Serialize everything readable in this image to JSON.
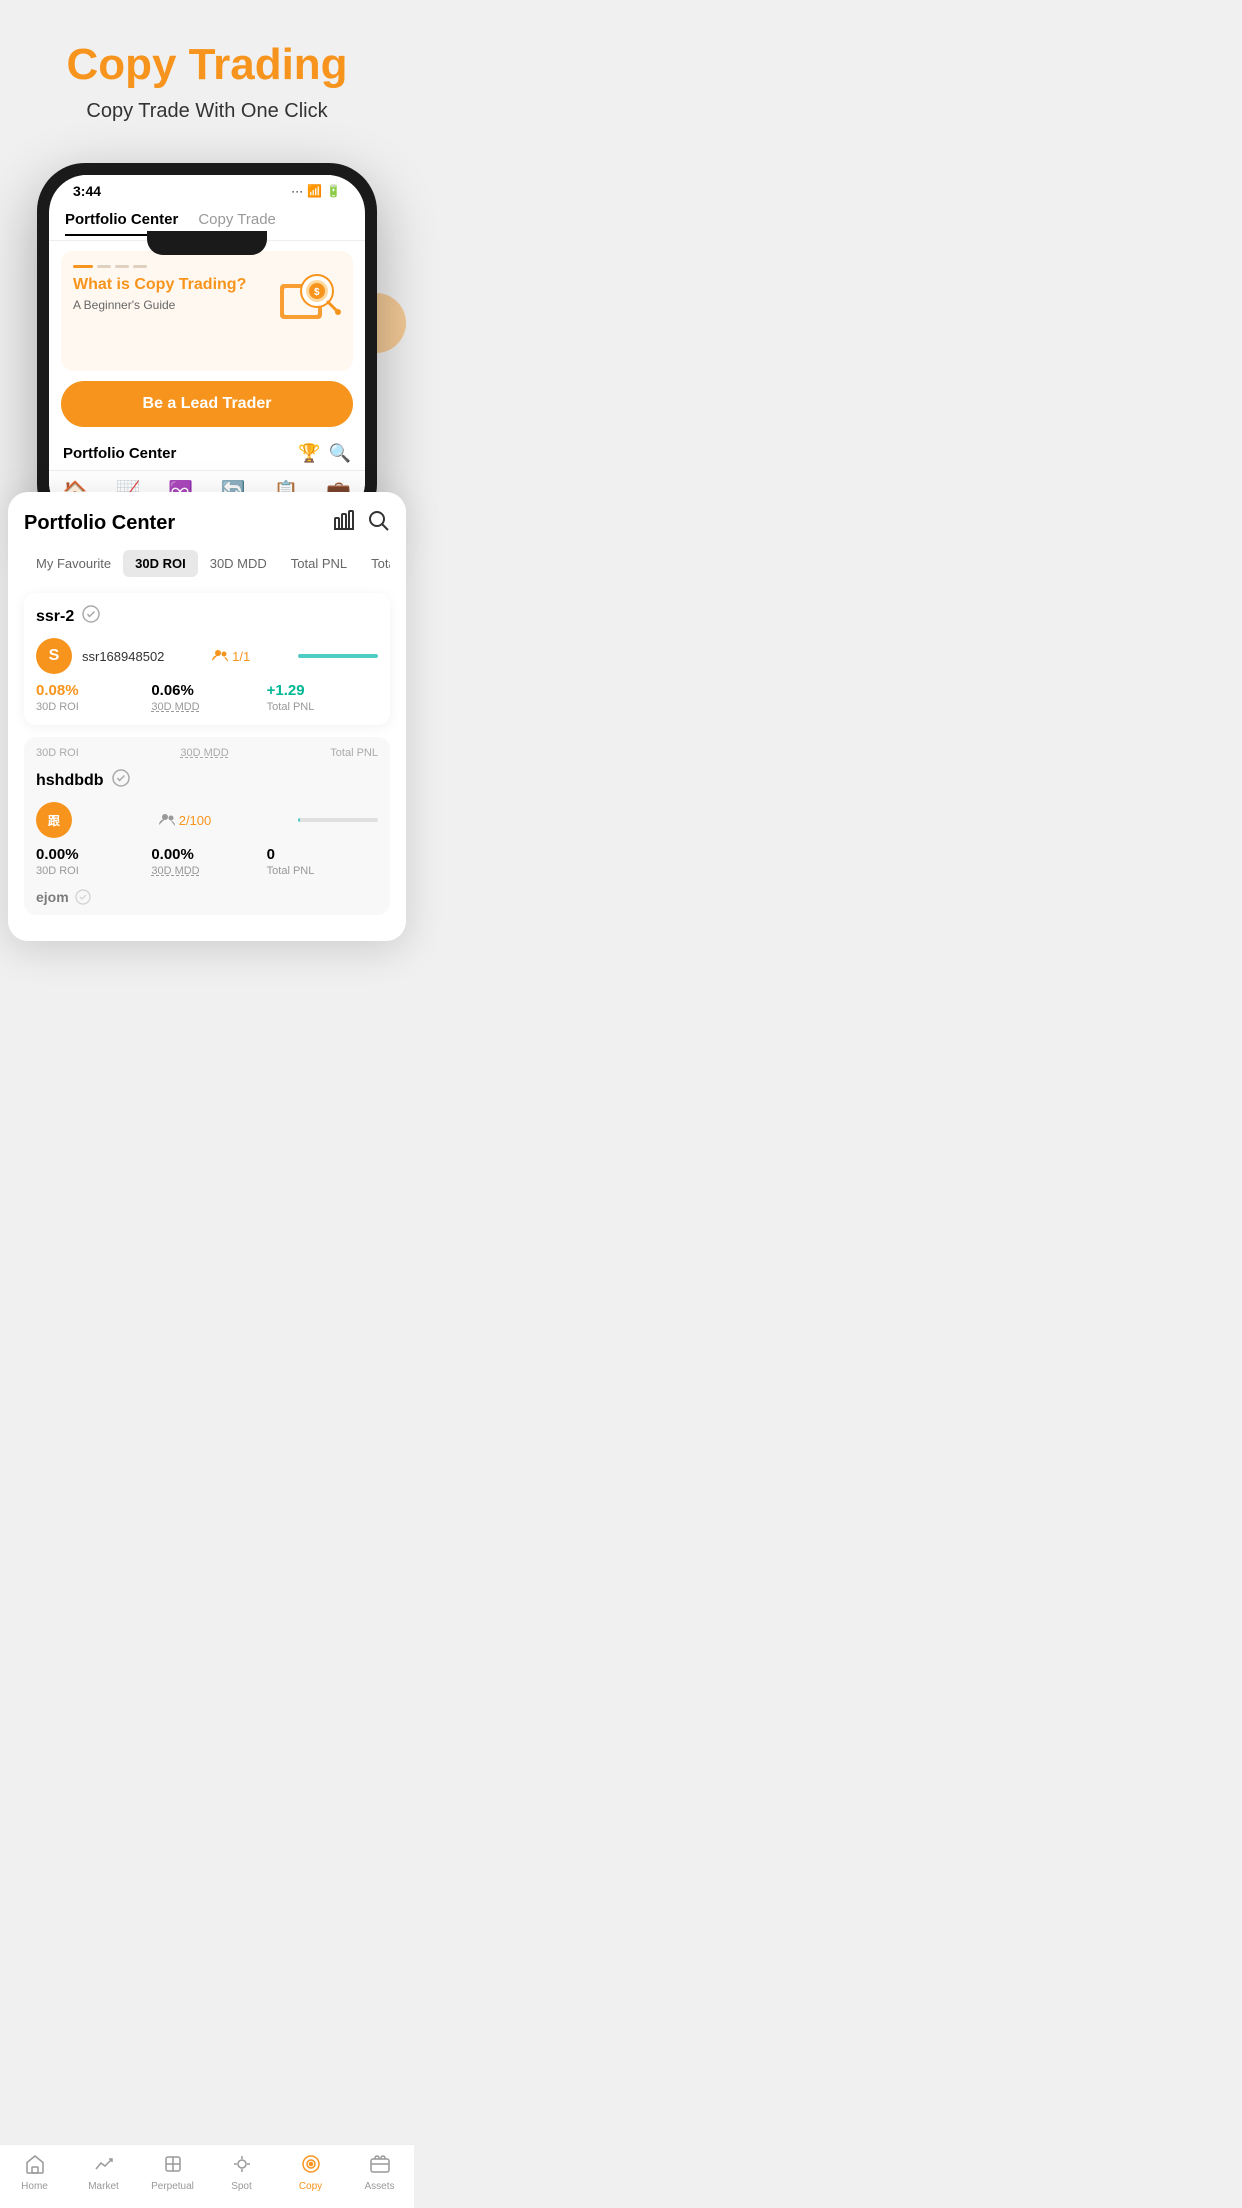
{
  "header": {
    "title": "Copy Trading",
    "subtitle": "Copy Trade With One Click"
  },
  "phone": {
    "status_time": "3:44",
    "nav": {
      "tab1": "Portfolio Center",
      "tab2": "Copy Trade"
    },
    "banner": {
      "title": "What is Copy Trading?",
      "subtitle": "A Beginner's Guide",
      "cta": "Be a Lead Trader"
    },
    "section_title": "Portfolio Center"
  },
  "portfolio_card": {
    "title": "Portfolio Center",
    "filters": [
      "My Favourite",
      "30D ROI",
      "30D MDD",
      "Total PNL",
      "Total Portfol"
    ],
    "active_filter": "30D ROI",
    "traders": [
      {
        "name": "ssr-2",
        "id": "ssr168948502",
        "followers": "1/1",
        "roi_value": "0.08%",
        "roi_label": "30D ROI",
        "mdd_value": "0.06%",
        "mdd_label": "30D MDD",
        "pnl_value": "+1.29",
        "pnl_label": "Total PNL",
        "pnl_color": "green",
        "progress": 100
      },
      {
        "name": "hshdbdb",
        "id": "",
        "followers": "2/100",
        "roi_value": "0.00%",
        "roi_label": "30D ROI",
        "mdd_value": "0.00%",
        "mdd_label": "30D MDD",
        "pnl_value": "0",
        "pnl_label": "Total PNL",
        "pnl_color": "black",
        "progress": 2
      }
    ],
    "partial_trader": {
      "name": "ejom"
    }
  },
  "bottom_nav": {
    "items": [
      "Home",
      "Market",
      "Perpetual",
      "Spot",
      "Copy",
      "Assets"
    ],
    "active": "Copy",
    "icons": [
      "🏠",
      "📈",
      "♾️",
      "🔄",
      "📋",
      "💼"
    ]
  }
}
